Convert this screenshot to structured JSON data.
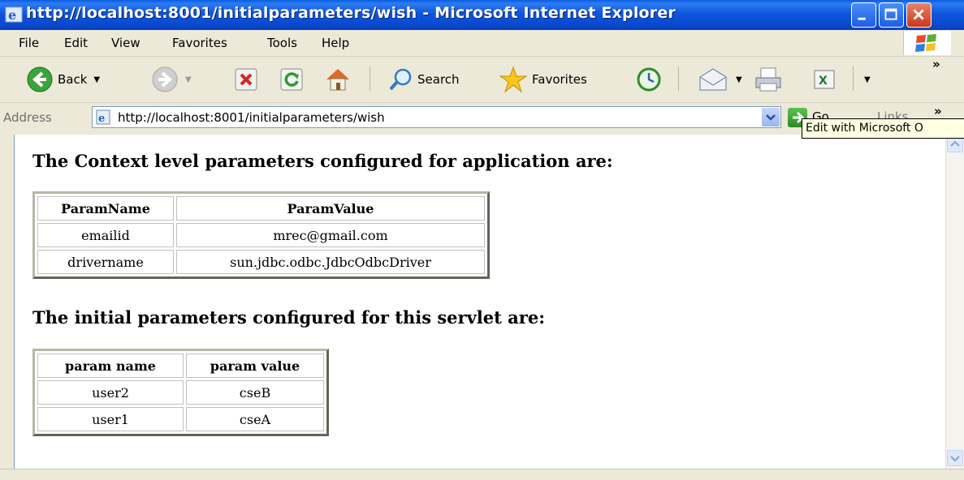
{
  "window": {
    "title": "http://localhost:8001/initialparameters/wish - Microsoft Internet Explorer"
  },
  "menu": [
    "File",
    "Edit",
    "View",
    "Favorites",
    "Tools",
    "Help"
  ],
  "toolbar": {
    "back_label": "Back",
    "search_label": "Search",
    "favorites_label": "Favorites",
    "more": "»"
  },
  "address": {
    "label": "Address",
    "url": "http://localhost:8001/initialparameters/wish",
    "go_label": "Go",
    "links_label": "Links",
    "links_more": "»"
  },
  "tooltip": "Edit with Microsoft O",
  "page": {
    "context_heading": "The Context level parameters configured for application are:",
    "context_table": {
      "headers": [
        "ParamName",
        "ParamValue"
      ],
      "rows": [
        [
          "emailid",
          "mrec@gmail.com"
        ],
        [
          "drivername",
          "sun.jdbc.odbc.JdbcOdbcDriver"
        ]
      ]
    },
    "init_heading": "The initial parameters configured for this servlet are:",
    "init_table": {
      "headers": [
        "param name",
        "param value"
      ],
      "rows": [
        [
          "user2",
          "cseB"
        ],
        [
          "user1",
          "cseA"
        ]
      ]
    }
  },
  "colors": {
    "titlebar": "#0a5de0",
    "chrome": "#ece9d8"
  }
}
